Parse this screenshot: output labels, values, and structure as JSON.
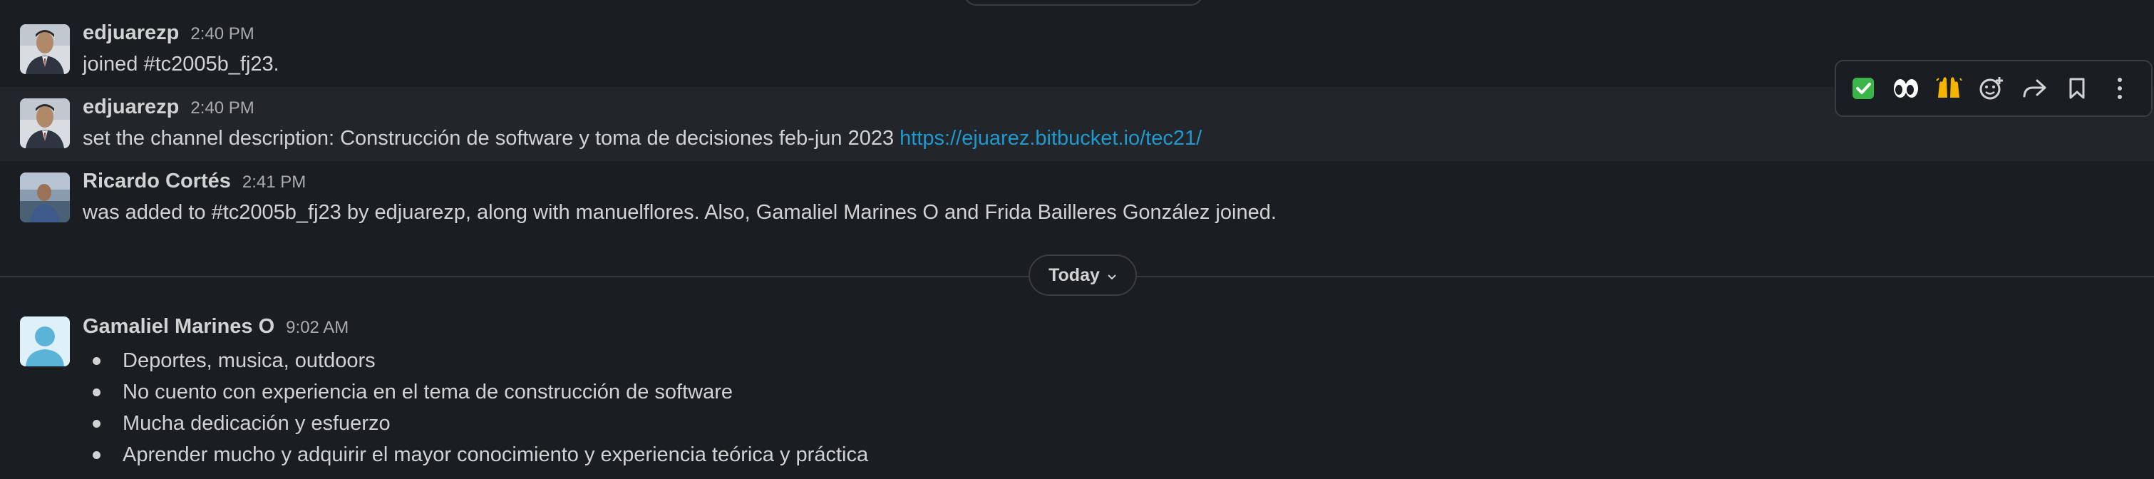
{
  "messages": [
    {
      "author": "edjuarezp",
      "time": "2:40 PM",
      "text": "joined #tc2005b_fj23."
    },
    {
      "author": "edjuarezp",
      "time": "2:40 PM",
      "text": "set the channel description: Construcción de software y toma de decisiones feb-jun 2023 ",
      "link": "https://ejuarez.bitbucket.io/tec21/"
    },
    {
      "author": "Ricardo Cortés",
      "time": "2:41 PM",
      "text": "was added to #tc2005b_fj23 by edjuarezp, along with manuelflores. Also, Gamaliel Marines O and Frida Bailleres González joined."
    }
  ],
  "day_divider": {
    "label": "Today",
    "icon": "chevron-down-icon"
  },
  "today_message": {
    "author": "Gamaliel Marines O",
    "time": "9:02 AM",
    "bullets": [
      "Deportes, musica, outdoors",
      "No cuento con experiencia en el tema de construcción de software",
      "Mucha dedicación y esfuerzo",
      "Aprender mucho y adquirir el mayor conocimiento y experiencia teórica y práctica"
    ]
  },
  "hover_toolbar": {
    "actions": [
      {
        "name": "react-check-mark-icon",
        "glyph": "✅"
      },
      {
        "name": "react-eyes-icon",
        "glyph": "👀"
      },
      {
        "name": "react-raised-hands-icon",
        "glyph": "🙌"
      },
      {
        "name": "add-reaction-icon"
      },
      {
        "name": "share-message-icon"
      },
      {
        "name": "save-bookmark-icon"
      },
      {
        "name": "more-actions-icon"
      }
    ]
  },
  "colors": {
    "background": "#1a1d21",
    "hover": "#222529",
    "text": "#d1d2d3",
    "link": "#1d9bd1",
    "muted": "#ababad"
  }
}
